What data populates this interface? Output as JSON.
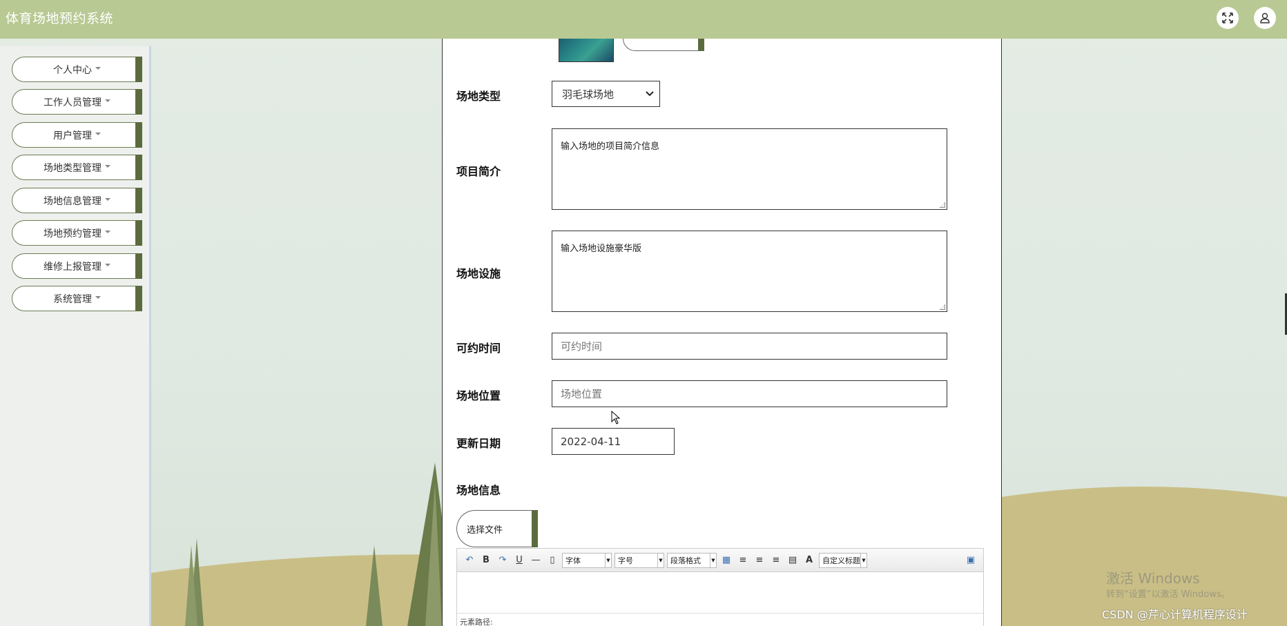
{
  "header": {
    "title": "体育场地预约系统",
    "fullscreen_icon": "fullscreen-icon",
    "user_icon": "user-icon"
  },
  "sidebar": {
    "items": [
      {
        "label": "个人中心"
      },
      {
        "label": "工作人员管理"
      },
      {
        "label": "用户管理"
      },
      {
        "label": "场地类型管理"
      },
      {
        "label": "场地信息管理"
      },
      {
        "label": "场地预约管理"
      },
      {
        "label": "维修上报管理"
      },
      {
        "label": "系统管理"
      }
    ]
  },
  "form": {
    "type_label": "场地类型",
    "type_value": "羽毛球场地",
    "intro_label": "项目简介",
    "intro_value": "输入场地的项目简介信息",
    "facility_label": "场地设施",
    "facility_value": "输入场地设施豪华版",
    "time_label": "可约时间",
    "time_placeholder": "可约时间",
    "location_label": "场地位置",
    "location_placeholder": "场地位置",
    "date_label": "更新日期",
    "date_value": "2022-04-11",
    "info_label": "场地信息",
    "choose_file": "选择文件"
  },
  "editor": {
    "font_family": "字体",
    "font_size": "字号",
    "paragraph": "段落格式",
    "custom_title": "自定义标题",
    "path_label": "元素路径:"
  },
  "overlay": {
    "activate_title": "激活 Windows",
    "activate_hint": "转到“设置”以激活 Windows。",
    "csdn": "CSDN @芹心计算机程序设计"
  },
  "colors": {
    "header_bg": "#b8c993",
    "accent_dark": "#5b6b3e"
  }
}
